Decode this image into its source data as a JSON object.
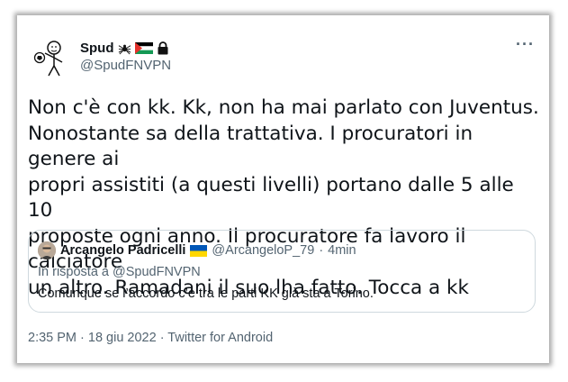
{
  "author": {
    "name": "Spud",
    "handle": "@SpudFNVPN"
  },
  "tweet": {
    "text": "Non c'è con kk. Kk, non ha mai parlato con Juventus.\nNonostante sa della trattativa. I procuratori in genere ai\npropri assistiti (a questi livelli) portano dalle 5 alle 10\nproposte ogni anno. Il procuratore fa lavoro il calciatore\nun altro. Ramadani il suo lha fatto. Tocca a kk",
    "more_label": "···"
  },
  "quoted": {
    "name": "Arcangelo Padricelli",
    "handle": "@ArcangeloP_79",
    "separator": "·",
    "time": "4min",
    "reply_to": "In risposta a @SpudFNVPN",
    "text": "Comunque se l’accordo c’è tra le parti KK già sta a Torino."
  },
  "meta": {
    "timestamp": "2:35 PM · 18 giu 2022 · Twitter for Android"
  },
  "colors": {
    "secondary_text": "#536471",
    "border": "#cfd9de",
    "primary_text": "#0f1419"
  },
  "icons": [
    "avatar-stick-figure",
    "spider-icon",
    "palestine-flag-icon",
    "lock-icon",
    "ukraine-flag-icon",
    "more-icon"
  ]
}
